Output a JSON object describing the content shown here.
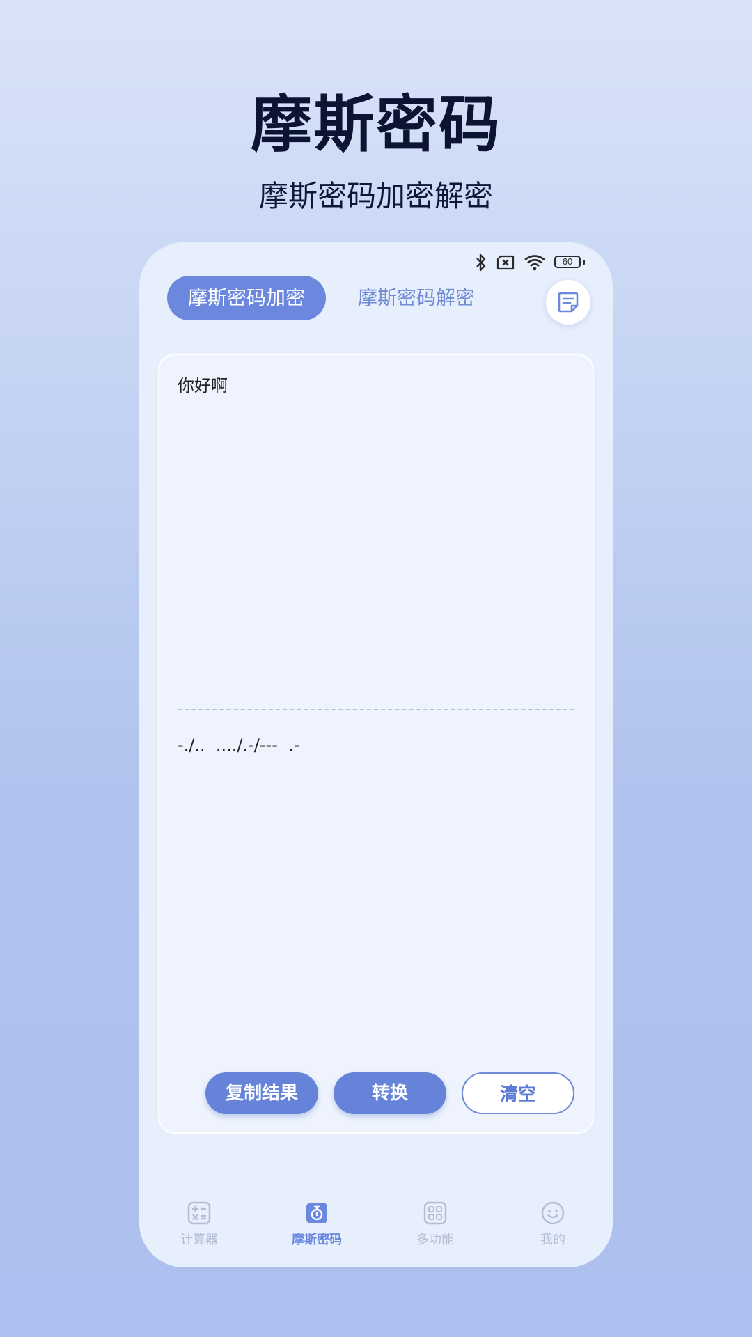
{
  "promo": {
    "title": "摩斯密码",
    "subtitle": "摩斯密码加密解密"
  },
  "status_bar": {
    "battery_level": "60",
    "icons": [
      "bluetooth-icon",
      "sim-x-icon",
      "wifi-icon",
      "battery-icon"
    ]
  },
  "tabs": [
    {
      "label": "摩斯密码加密",
      "active": true
    },
    {
      "label": "摩斯密码解密",
      "active": false
    }
  ],
  "note_button": {
    "icon": "note-icon"
  },
  "editor": {
    "input_text": "你好啊",
    "output_text": "-./..  ..../.-/---  .-"
  },
  "actions": {
    "copy_label": "复制结果",
    "convert_label": "转换",
    "clear_label": "清空"
  },
  "nav": [
    {
      "label": "计算器",
      "icon": "calculator-icon",
      "active": false
    },
    {
      "label": "摩斯密码",
      "icon": "morse-lock-icon",
      "active": true
    },
    {
      "label": "多功能",
      "icon": "grid-icon",
      "active": false
    },
    {
      "label": "我的",
      "icon": "smile-icon",
      "active": false
    }
  ],
  "colors": {
    "accent": "#6b88de",
    "background": "#b0c2ee",
    "card": "#eef3fd",
    "title": "#0b1433"
  }
}
